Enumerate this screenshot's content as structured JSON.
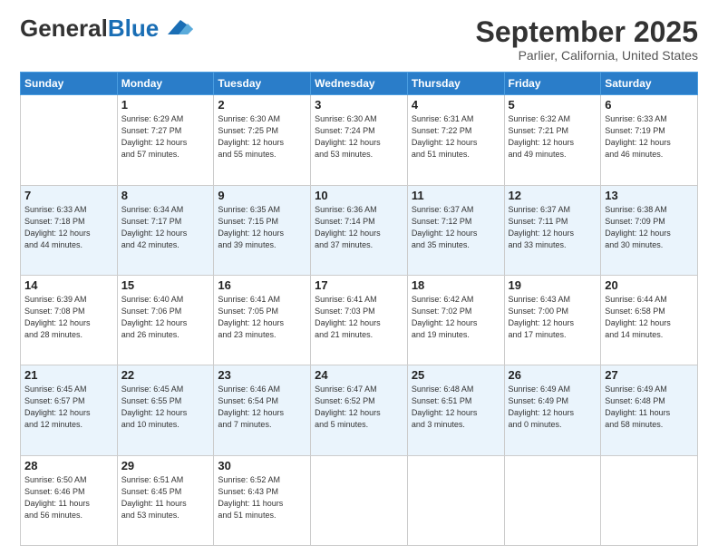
{
  "header": {
    "logo_line1": "General",
    "logo_line2": "Blue",
    "month": "September 2025",
    "location": "Parlier, California, United States"
  },
  "days_of_week": [
    "Sunday",
    "Monday",
    "Tuesday",
    "Wednesday",
    "Thursday",
    "Friday",
    "Saturday"
  ],
  "weeks": [
    [
      {
        "day": "",
        "info": ""
      },
      {
        "day": "1",
        "info": "Sunrise: 6:29 AM\nSunset: 7:27 PM\nDaylight: 12 hours\nand 57 minutes."
      },
      {
        "day": "2",
        "info": "Sunrise: 6:30 AM\nSunset: 7:25 PM\nDaylight: 12 hours\nand 55 minutes."
      },
      {
        "day": "3",
        "info": "Sunrise: 6:30 AM\nSunset: 7:24 PM\nDaylight: 12 hours\nand 53 minutes."
      },
      {
        "day": "4",
        "info": "Sunrise: 6:31 AM\nSunset: 7:22 PM\nDaylight: 12 hours\nand 51 minutes."
      },
      {
        "day": "5",
        "info": "Sunrise: 6:32 AM\nSunset: 7:21 PM\nDaylight: 12 hours\nand 49 minutes."
      },
      {
        "day": "6",
        "info": "Sunrise: 6:33 AM\nSunset: 7:19 PM\nDaylight: 12 hours\nand 46 minutes."
      }
    ],
    [
      {
        "day": "7",
        "info": "Sunrise: 6:33 AM\nSunset: 7:18 PM\nDaylight: 12 hours\nand 44 minutes."
      },
      {
        "day": "8",
        "info": "Sunrise: 6:34 AM\nSunset: 7:17 PM\nDaylight: 12 hours\nand 42 minutes."
      },
      {
        "day": "9",
        "info": "Sunrise: 6:35 AM\nSunset: 7:15 PM\nDaylight: 12 hours\nand 39 minutes."
      },
      {
        "day": "10",
        "info": "Sunrise: 6:36 AM\nSunset: 7:14 PM\nDaylight: 12 hours\nand 37 minutes."
      },
      {
        "day": "11",
        "info": "Sunrise: 6:37 AM\nSunset: 7:12 PM\nDaylight: 12 hours\nand 35 minutes."
      },
      {
        "day": "12",
        "info": "Sunrise: 6:37 AM\nSunset: 7:11 PM\nDaylight: 12 hours\nand 33 minutes."
      },
      {
        "day": "13",
        "info": "Sunrise: 6:38 AM\nSunset: 7:09 PM\nDaylight: 12 hours\nand 30 minutes."
      }
    ],
    [
      {
        "day": "14",
        "info": "Sunrise: 6:39 AM\nSunset: 7:08 PM\nDaylight: 12 hours\nand 28 minutes."
      },
      {
        "day": "15",
        "info": "Sunrise: 6:40 AM\nSunset: 7:06 PM\nDaylight: 12 hours\nand 26 minutes."
      },
      {
        "day": "16",
        "info": "Sunrise: 6:41 AM\nSunset: 7:05 PM\nDaylight: 12 hours\nand 23 minutes."
      },
      {
        "day": "17",
        "info": "Sunrise: 6:41 AM\nSunset: 7:03 PM\nDaylight: 12 hours\nand 21 minutes."
      },
      {
        "day": "18",
        "info": "Sunrise: 6:42 AM\nSunset: 7:02 PM\nDaylight: 12 hours\nand 19 minutes."
      },
      {
        "day": "19",
        "info": "Sunrise: 6:43 AM\nSunset: 7:00 PM\nDaylight: 12 hours\nand 17 minutes."
      },
      {
        "day": "20",
        "info": "Sunrise: 6:44 AM\nSunset: 6:58 PM\nDaylight: 12 hours\nand 14 minutes."
      }
    ],
    [
      {
        "day": "21",
        "info": "Sunrise: 6:45 AM\nSunset: 6:57 PM\nDaylight: 12 hours\nand 12 minutes."
      },
      {
        "day": "22",
        "info": "Sunrise: 6:45 AM\nSunset: 6:55 PM\nDaylight: 12 hours\nand 10 minutes."
      },
      {
        "day": "23",
        "info": "Sunrise: 6:46 AM\nSunset: 6:54 PM\nDaylight: 12 hours\nand 7 minutes."
      },
      {
        "day": "24",
        "info": "Sunrise: 6:47 AM\nSunset: 6:52 PM\nDaylight: 12 hours\nand 5 minutes."
      },
      {
        "day": "25",
        "info": "Sunrise: 6:48 AM\nSunset: 6:51 PM\nDaylight: 12 hours\nand 3 minutes."
      },
      {
        "day": "26",
        "info": "Sunrise: 6:49 AM\nSunset: 6:49 PM\nDaylight: 12 hours\nand 0 minutes."
      },
      {
        "day": "27",
        "info": "Sunrise: 6:49 AM\nSunset: 6:48 PM\nDaylight: 11 hours\nand 58 minutes."
      }
    ],
    [
      {
        "day": "28",
        "info": "Sunrise: 6:50 AM\nSunset: 6:46 PM\nDaylight: 11 hours\nand 56 minutes."
      },
      {
        "day": "29",
        "info": "Sunrise: 6:51 AM\nSunset: 6:45 PM\nDaylight: 11 hours\nand 53 minutes."
      },
      {
        "day": "30",
        "info": "Sunrise: 6:52 AM\nSunset: 6:43 PM\nDaylight: 11 hours\nand 51 minutes."
      },
      {
        "day": "",
        "info": ""
      },
      {
        "day": "",
        "info": ""
      },
      {
        "day": "",
        "info": ""
      },
      {
        "day": "",
        "info": ""
      }
    ]
  ]
}
